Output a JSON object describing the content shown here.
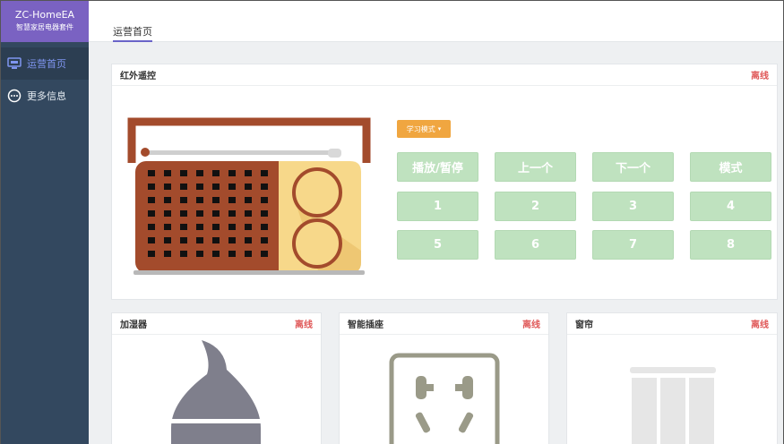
{
  "sidebar": {
    "brand_title": "ZC-HomeEA",
    "brand_subtitle": "智慧家居电器套件",
    "items": [
      {
        "label": "运营首页",
        "icon": "monitor-icon",
        "active": true
      },
      {
        "label": "更多信息",
        "icon": "more-circle-icon",
        "active": false
      }
    ]
  },
  "header": {
    "tab": "运营首页"
  },
  "ir_card": {
    "title": "红外遥控",
    "status": "离线",
    "mode_button": "学习模式",
    "buttons": [
      "播放/暂停",
      "上一个",
      "下一个",
      "模式",
      "1",
      "2",
      "3",
      "4",
      "5",
      "6",
      "7",
      "8"
    ]
  },
  "cards": [
    {
      "title": "加湿器",
      "status": "离线"
    },
    {
      "title": "智能插座",
      "status": "离线"
    },
    {
      "title": "窗帘",
      "status": "离线"
    }
  ],
  "colors": {
    "sidebar": "#33485f",
    "brand": "#7a62c2",
    "offline": "#e05a5a",
    "button_green": "#bfe2bf",
    "mode_orange": "#f0a640"
  }
}
